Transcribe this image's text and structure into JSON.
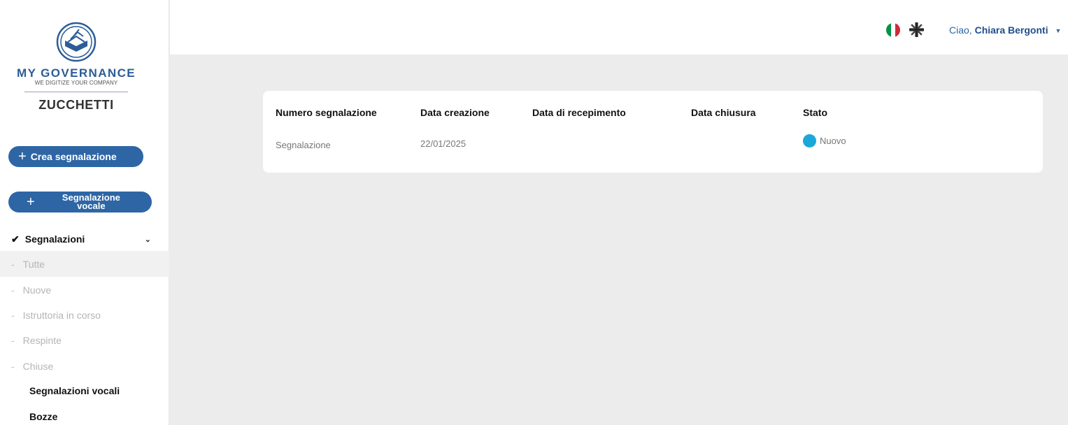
{
  "brand": {
    "name": "MY GOVERNANCE",
    "tagline": "WE DIGITIZE YOUR COMPANY",
    "company": "ZUCCHETTI",
    "color": "#2c5d97"
  },
  "sidebar": {
    "create_button": "Crea segnalazione",
    "voice_button": "Segnalazione vocale",
    "section": "Segnalazioni",
    "sub_items": [
      "Tutte",
      "Nuove",
      "Istruttoria in corso",
      "Respinte",
      "Chiuse"
    ],
    "active_sub_item": "Tutte",
    "voice_reports": "Segnalazioni vocali",
    "drafts": "Bozze"
  },
  "header": {
    "greeting": "Ciao,",
    "user_name": "Chiara Bergonti",
    "languages": [
      "it-flag-icon",
      "uk-flag-icon"
    ]
  },
  "table": {
    "columns": [
      "Numero segnalazione",
      "Data creazione",
      "Data di recepimento",
      "Data chiusura",
      "Stato"
    ],
    "rows": [
      {
        "numero": "Segnalazione",
        "data_creazione": "22/01/2025",
        "data_recepimento": "",
        "data_chiusura": "",
        "stato": "Nuovo",
        "stato_color": "#1ba7d9"
      }
    ]
  },
  "colors": {
    "accent": "#2e66a5",
    "background": "#ececec"
  }
}
